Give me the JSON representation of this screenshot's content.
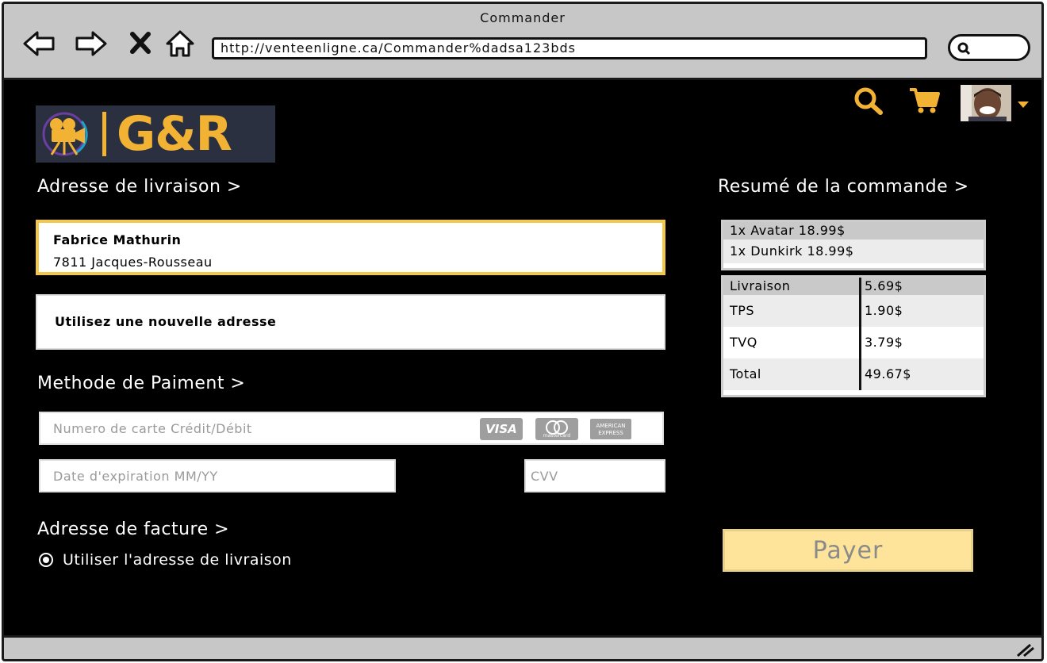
{
  "window": {
    "title": "Commander"
  },
  "browser": {
    "url": "http://venteenligne.ca/Commander%dadsa123bds"
  },
  "logo": {
    "text": "G&R"
  },
  "shipping": {
    "title": "Adresse de livraison >",
    "selected_name": "Fabrice Mathurin",
    "selected_street": "7811 Jacques-Rousseau",
    "new_address_label": "Utilisez une nouvelle adresse"
  },
  "payment": {
    "title": "Methode de Paiment >",
    "card_placeholder": "Numero de carte Crédit/Débit",
    "expiry_placeholder": "Date d'expiration MM/YY",
    "cvv_placeholder": "CVV",
    "card_brands": [
      "VISA",
      "mastercard",
      "AMERICAN EXPRESS"
    ]
  },
  "billing": {
    "title": "Adresse de facture >",
    "use_shipping_label": "Utiliser l'adresse de livraison",
    "use_shipping_selected": true
  },
  "summary": {
    "title": "Resumé de la commande >",
    "items": [
      "1x Avatar 18.99$",
      "1x Dunkirk 18.99$"
    ],
    "totals": [
      {
        "label": "Livraison",
        "value": "5.69$"
      },
      {
        "label": "TPS",
        "value": "1.90$"
      },
      {
        "label": "TVQ",
        "value": "3.79$"
      },
      {
        "label": "Total",
        "value": "49.67$"
      }
    ]
  },
  "pay_button": {
    "label": "Payer"
  },
  "colors": {
    "accent": "#f2b233",
    "pay_button_bg": "#fde49a",
    "page_bg": "#000000",
    "chrome": "#c7c7c7"
  }
}
